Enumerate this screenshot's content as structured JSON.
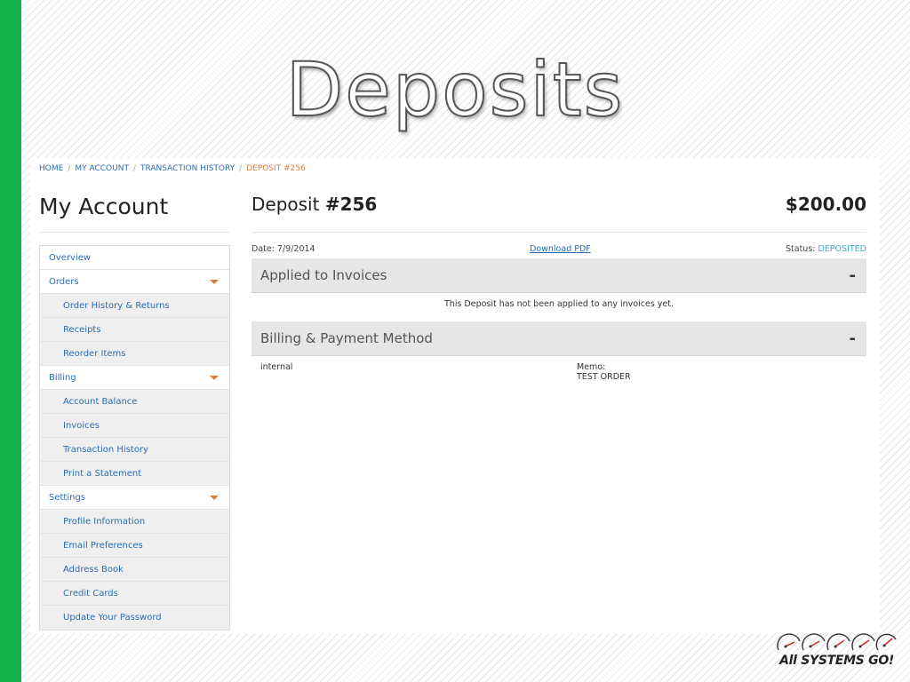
{
  "slide": {
    "title": "Deposits"
  },
  "breadcrumb": {
    "items": [
      "HOME",
      "MY ACCOUNT",
      "TRANSACTION HISTORY"
    ],
    "current": "DEPOSIT #256"
  },
  "sidebar": {
    "title": "My Account",
    "items": [
      {
        "label": "Overview",
        "type": "top",
        "caret": false
      },
      {
        "label": "Orders",
        "type": "top",
        "caret": true
      },
      {
        "label": "Order History & Returns",
        "type": "sub",
        "caret": false
      },
      {
        "label": "Receipts",
        "type": "sub",
        "caret": false
      },
      {
        "label": "Reorder Items",
        "type": "sub",
        "caret": false
      },
      {
        "label": "Billing",
        "type": "top",
        "caret": true
      },
      {
        "label": "Account Balance",
        "type": "sub",
        "caret": false
      },
      {
        "label": "Invoices",
        "type": "sub",
        "caret": false
      },
      {
        "label": "Transaction History",
        "type": "sub",
        "caret": false
      },
      {
        "label": "Print a Statement",
        "type": "sub",
        "caret": false
      },
      {
        "label": "Settings",
        "type": "top",
        "caret": true
      },
      {
        "label": "Profile Information",
        "type": "sub",
        "caret": false
      },
      {
        "label": "Email Preferences",
        "type": "sub",
        "caret": false
      },
      {
        "label": "Address Book",
        "type": "sub",
        "caret": false
      },
      {
        "label": "Credit Cards",
        "type": "sub",
        "caret": false
      },
      {
        "label": "Update Your Password",
        "type": "sub",
        "caret": false
      }
    ]
  },
  "deposit": {
    "title_prefix": "Deposit",
    "number": "#256",
    "amount": "$200.00",
    "date": "Date: 7/9/2014",
    "download_label": "Download PDF",
    "status_label": "Status:",
    "status_value": "DEPOSITED"
  },
  "applied_panel": {
    "title": "Applied to Invoices",
    "toggle": "-",
    "message": "This Deposit has not been applied to any invoices yet."
  },
  "billing_panel": {
    "title": "Billing & Payment Method",
    "toggle": "-",
    "method": "internal",
    "memo_label": "Memo:",
    "memo_value": "TEST ORDER"
  },
  "logo": {
    "text": "All SYSTEMS GO!"
  },
  "colors": {
    "accent_green": "#13b24b",
    "link_blue": "#2a6db5",
    "breadcrumb_current": "#e07b3a",
    "status_value": "#3aaecb",
    "caret_orange": "#e07b3a"
  }
}
